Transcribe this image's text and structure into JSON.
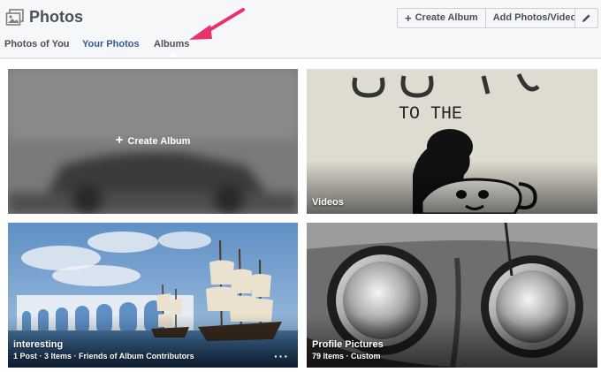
{
  "header": {
    "title": "Photos",
    "create_album_label": "Create Album",
    "add_photos_label": "Add Photos/Video"
  },
  "tabs": [
    {
      "label": "Photos of You",
      "active": false
    },
    {
      "label": "Your Photos",
      "active": false
    },
    {
      "label": "Albums",
      "active": true
    }
  ],
  "albums": {
    "create_label": "Create Album",
    "items": [
      {
        "title": "Videos",
        "meta": ""
      },
      {
        "title": "interesting",
        "meta": "1 Post · 3 Items · Friends of Album Contributors"
      },
      {
        "title": "Profile Pictures",
        "meta": "79 Items · Custom"
      }
    ]
  },
  "videos_art_text": "TO THE",
  "colors": {
    "accent_link": "#365899",
    "annotation_arrow": "#e8326c",
    "header_bg": "#f6f7f9"
  }
}
